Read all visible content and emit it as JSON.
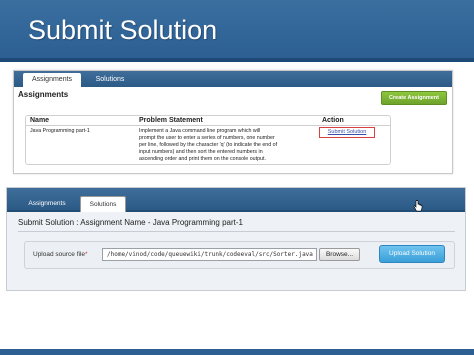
{
  "slide": {
    "title": "Submit Solution"
  },
  "screenshot_1": {
    "tabs": [
      {
        "label": "Assignments",
        "active": true
      },
      {
        "label": "Solutions",
        "active": false
      }
    ],
    "section_title": "Assignments",
    "create_button": "Create Assignment",
    "table": {
      "headers": [
        "Name",
        "Problem Statement",
        "Action"
      ],
      "rows": [
        {
          "name": "Java Programming part-1",
          "statement_lines": [
            "Implement a Java command line program which will",
            "prompt the user to enter a series of numbers, one number",
            "per line, followed by the character 'q' (to indicate the end of",
            "input numbers) and then sort the entered numbers in",
            "ascending order and print them on the console output."
          ],
          "action": "Submit Solution"
        }
      ]
    }
  },
  "screenshot_2": {
    "tabs": [
      {
        "label": "Assignments",
        "active": false
      },
      {
        "label": "Solutions",
        "active": true
      }
    ],
    "section_title": "Submit Solution : Assignment Name - Java Programming part-1",
    "upload": {
      "label": "Upload source file",
      "required_marker": "*",
      "file_path": "/home/vinod/code/queuewiki/trunk/codeeval/src/Sorter.java",
      "browse_button": "Browse...",
      "upload_button": "Upload Solution"
    }
  },
  "colors": {
    "header_blue": "#2d5f92",
    "create_green": "#7ab536",
    "upload_blue": "#3a9fd8",
    "highlight_red": "#d94040"
  }
}
